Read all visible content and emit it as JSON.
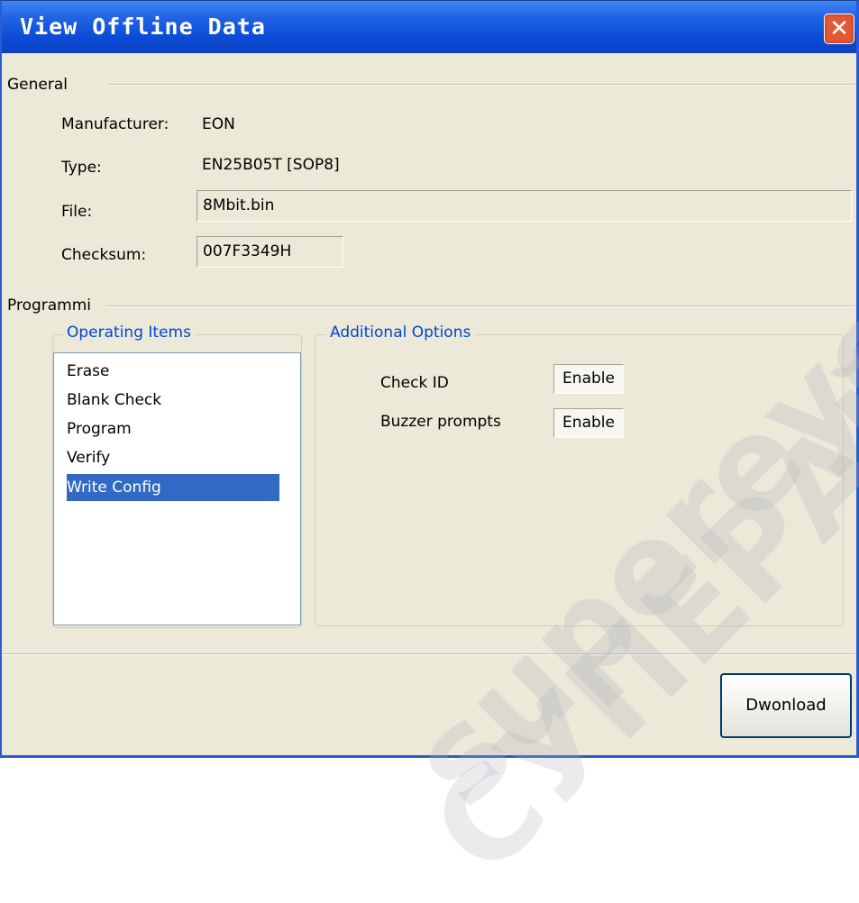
{
  "window": {
    "title": "View Offline Data"
  },
  "general": {
    "section_label": "General",
    "manufacturer_label": "Manufacturer:",
    "manufacturer_value": "EON",
    "type_label": "Type:",
    "type_value": "EN25B05T [SOP8]",
    "file_label": "File:",
    "file_value": "8Mbit.bin",
    "checksum_label": "Checksum:",
    "checksum_value": "007F3349H"
  },
  "programming": {
    "section_label": "Programmi",
    "operating_items": {
      "caption": "Operating Items",
      "items": [
        "Erase",
        "Blank Check",
        "Program",
        "Verify",
        "Write Config"
      ],
      "selected": "Write Config"
    },
    "additional_options": {
      "caption": "Additional Options",
      "options": [
        {
          "label": "Check ID",
          "value": "Enable"
        },
        {
          "label": "Buzzer prompts",
          "value": "Enable"
        }
      ]
    }
  },
  "footer": {
    "download_label": "Dwonload"
  },
  "watermark": {
    "text1": "supereyes.ru",
    "text2": "СУПЕРАЙС"
  }
}
